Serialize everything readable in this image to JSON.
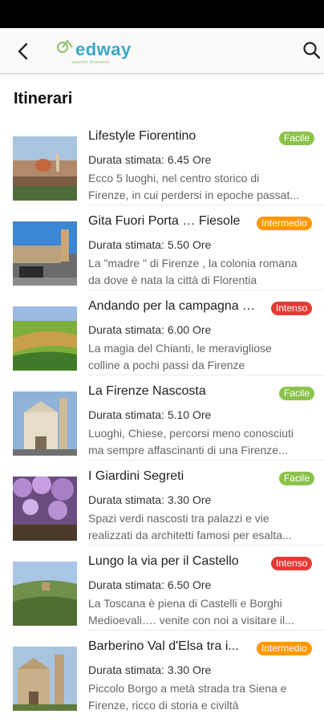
{
  "app": {
    "logo_text": "edway",
    "logo_tagline": "autentic itineraries"
  },
  "header": {
    "back_icon": "back-arrow-icon",
    "search_icon": "search-icon"
  },
  "page": {
    "title": "Itinerari"
  },
  "colors": {
    "easy": "#8bc34a",
    "intermediate": "#ff9800",
    "intense": "#e53935",
    "brand": "#3aa8c7"
  },
  "itineraries": [
    {
      "title": "Lifestyle Fiorentino",
      "level": "Facile",
      "level_type": "easy",
      "duration": "Durata stimata: 6.45 Ore",
      "desc1": "Ecco 5 luoghi, nel centro storico di",
      "desc2": "Firenze, in cui perdersi in epoche passat..."
    },
    {
      "title": "Gita Fuori Porta … Fiesole",
      "level": "Intermedio",
      "level_type": "mid",
      "duration": "Durata stimata: 5.50 Ore",
      "desc1": "La \"madre \" di Firenze , la colonia romana",
      "desc2": "da dove è nata la città di Florentia"
    },
    {
      "title": "Andando per la campagna …",
      "level": "Intenso",
      "level_type": "hard",
      "duration": "Durata stimata: 6.00 Ore",
      "desc1": "La magia del Chianti, le meravigliose",
      "desc2": "colline a pochi passi da Firenze"
    },
    {
      "title": "La Firenze Nascosta",
      "level": "Facile",
      "level_type": "easy",
      "duration": "Durata stimata: 5.10 Ore",
      "desc1": "Luoghi, Chiese, percorsi meno conosciuti",
      "desc2": "ma sempre affascinanti di una Firenze..."
    },
    {
      "title": "I Giardini Segreti",
      "level": "Facile",
      "level_type": "easy",
      "duration": "Durata stimata: 3.30 Ore",
      "desc1": "Spazi verdi nascosti tra palazzi e vie",
      "desc2": "realizzati da architetti famosi per esalta..."
    },
    {
      "title": "Lungo la via per il Castello",
      "level": "Intenso",
      "level_type": "hard",
      "duration": "Durata stimata: 6.50 Ore",
      "desc1": "La Toscana è piena di Castelli e Borghi",
      "desc2": "Medioevali…. venite con noi a visitare il..."
    },
    {
      "title": "Barberino Val d'Elsa tra i...",
      "level": "Intermedio",
      "level_type": "mid",
      "duration": "Durata stimata: 3.30 Ore",
      "desc1": "Piccolo Borgo a metà strada tra Siena e",
      "desc2": "Firenze, ricco di storia e civiltà"
    }
  ]
}
